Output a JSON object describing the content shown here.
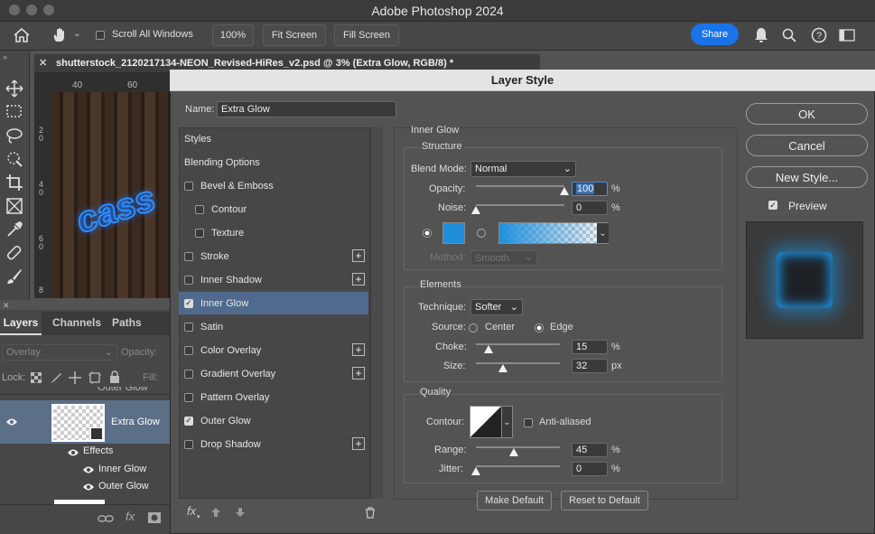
{
  "app": {
    "title": "Adobe Photoshop 2024"
  },
  "options_bar": {
    "scroll_all_windows": "Scroll All Windows",
    "zoom": "100%",
    "fit_screen": "Fit Screen",
    "fill_screen": "Fill Screen",
    "share": "Share"
  },
  "document": {
    "tab_title": "shutterstock_2120217134-NEON_Revised-HiRes_v2.psd @ 3% (Extra Glow, RGB/8) *",
    "ruler_40": "40",
    "ruler_60": "60",
    "vruler_2": "2",
    "vruler_0a": "0",
    "vruler_4": "4",
    "vruler_0b": "0",
    "vruler_6": "6",
    "vruler_0c": "0",
    "vruler_8": "8",
    "neon_text": "cass"
  },
  "layers_panel": {
    "tabs": [
      "Layers",
      "Channels",
      "Paths"
    ],
    "blend": "Overlay",
    "opacity_label": "Opacity:",
    "lock_label": "Lock:",
    "fill_label": "Fill:",
    "partial_layer": "Outer Glow",
    "layer_name": "Extra Glow",
    "effects_label": "Effects",
    "effects": [
      "Inner Glow",
      "Outer Glow"
    ]
  },
  "dialog": {
    "title": "Layer Style",
    "name_label": "Name:",
    "name_value": "Extra Glow",
    "styles": [
      {
        "label": "Styles",
        "check": "none"
      },
      {
        "label": "Blending Options",
        "check": "none"
      },
      {
        "label": "Bevel & Emboss",
        "check": "off"
      },
      {
        "label": "Contour",
        "check": "off",
        "indent": true
      },
      {
        "label": "Texture",
        "check": "off",
        "indent": true
      },
      {
        "label": "Stroke",
        "check": "off",
        "plus": true
      },
      {
        "label": "Inner Shadow",
        "check": "off",
        "plus": true
      },
      {
        "label": "Inner Glow",
        "check": "on",
        "selected": true
      },
      {
        "label": "Satin",
        "check": "off"
      },
      {
        "label": "Color Overlay",
        "check": "off",
        "plus": true
      },
      {
        "label": "Gradient Overlay",
        "check": "off",
        "plus": true
      },
      {
        "label": "Pattern Overlay",
        "check": "off"
      },
      {
        "label": "Outer Glow",
        "check": "on"
      },
      {
        "label": "Drop Shadow",
        "check": "off",
        "plus": true
      }
    ],
    "fx_label": "fx",
    "section_title": "Inner Glow",
    "structure": {
      "title": "Structure",
      "blend_mode_label": "Blend Mode:",
      "blend_mode": "Normal",
      "opacity_label": "Opacity:",
      "opacity": "100",
      "noise_label": "Noise:",
      "noise": "0",
      "opacity_level": 100,
      "noise_level": 0,
      "pct": "%",
      "method_label": "Method:",
      "method": "Smooth",
      "glow_color": "#1f8fdc"
    },
    "elements": {
      "title": "Elements",
      "technique_label": "Technique:",
      "technique": "Softer",
      "source_label": "Source:",
      "center": "Center",
      "edge": "Edge",
      "choke_label": "Choke:",
      "choke": "15",
      "size_label": "Size:",
      "size": "32",
      "choke_level": 15,
      "size_level": 32,
      "px": "px"
    },
    "quality": {
      "title": "Quality",
      "contour_label": "Contour:",
      "anti_aliased": "Anti-aliased",
      "range_label": "Range:",
      "range": "45",
      "jitter_label": "Jitter:",
      "jitter": "0",
      "range_level": 45,
      "jitter_level": 0
    },
    "make_default": "Make Default",
    "reset_default": "Reset to Default",
    "ok": "OK",
    "cancel": "Cancel",
    "new_style": "New Style...",
    "preview": "Preview"
  }
}
